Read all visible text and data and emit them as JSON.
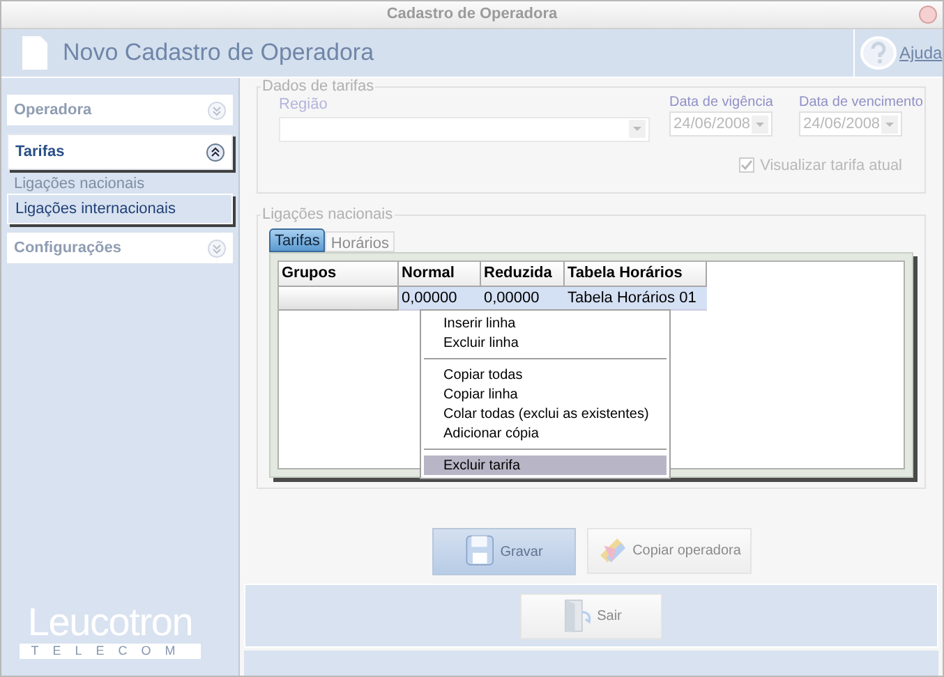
{
  "window": {
    "title": "Cadastro de Operadora"
  },
  "header": {
    "title": "Novo Cadastro de Operadora",
    "help": "Ajuda"
  },
  "sidebar": {
    "sections": [
      {
        "label": "Operadora",
        "expanded": false
      },
      {
        "label": "Tarifas",
        "expanded": true,
        "items": [
          {
            "label": "Ligações nacionais",
            "selected": false
          },
          {
            "label": "Ligações internacionais",
            "selected": true
          }
        ]
      },
      {
        "label": "Configurações",
        "expanded": false
      }
    ],
    "logo": {
      "name": "Leucotron",
      "tagline": "TELECOM"
    }
  },
  "tariff_data": {
    "legend": "Dados de tarifas",
    "region": {
      "label": "Região"
    },
    "dates": [
      {
        "label": "Data de vigência",
        "value": "24/06/2008"
      },
      {
        "label": "Data de vencimento",
        "value": "24/06/2008"
      }
    ],
    "show_current": {
      "label": "Visualizar tarifa atual",
      "checked": true
    }
  },
  "calls": {
    "legend": "Ligações nacionais",
    "tabs": [
      {
        "label": "Tarifas",
        "selected": true
      },
      {
        "label": "Horários",
        "selected": false
      }
    ],
    "table": {
      "columns": [
        "Grupos",
        "Normal",
        "Reduzida",
        "Tabela Horários"
      ],
      "rows": [
        {
          "cells": [
            "",
            "0,00000",
            "0,00000",
            "Tabela Horários 01"
          ],
          "selected": true
        }
      ]
    }
  },
  "context_menu": [
    {
      "kind": "item",
      "label": "Inserir linha",
      "selected": false
    },
    {
      "kind": "item",
      "label": "Excluir linha",
      "selected": false
    },
    {
      "kind": "separator"
    },
    {
      "kind": "item",
      "label": "Copiar todas",
      "selected": false
    },
    {
      "kind": "item",
      "label": "Copiar linha",
      "selected": false
    },
    {
      "kind": "item",
      "label": "Colar todas (exclui as existentes)",
      "selected": false
    },
    {
      "kind": "item",
      "label": "Adicionar cópia",
      "selected": false
    },
    {
      "kind": "separator"
    },
    {
      "kind": "item",
      "label": "Excluir tarifa",
      "selected": true
    }
  ],
  "actions": [
    {
      "kind": "save",
      "label": "Gravar",
      "focused": true
    },
    {
      "kind": "copy",
      "label": "Copiar operadora",
      "focused": false
    }
  ],
  "exit": {
    "kind": "exit",
    "label": "Sair",
    "focused": false
  }
}
